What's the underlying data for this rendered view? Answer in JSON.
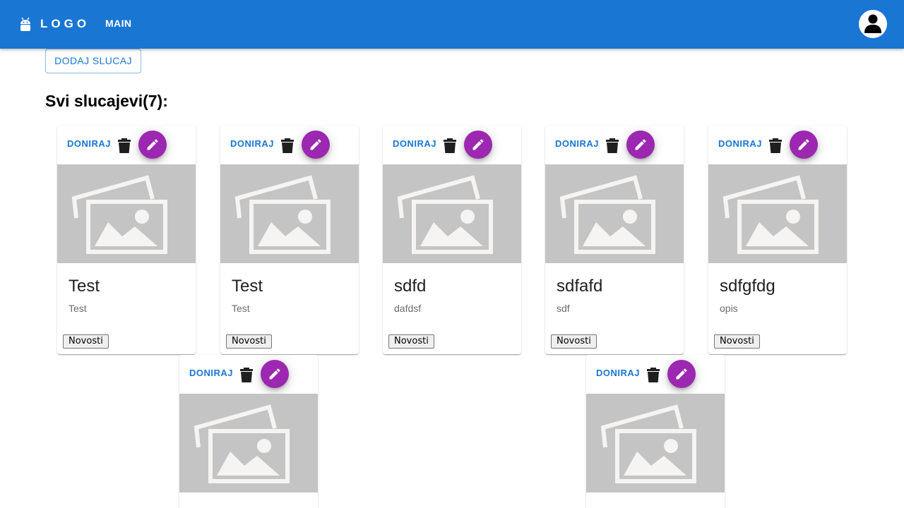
{
  "header": {
    "logo_text": "LOGO",
    "nav_main": "MAIN",
    "bar_color": "#1976d2"
  },
  "toolbar": {
    "add_case_label": "DODAJ SLUCAJ"
  },
  "page_title": "Svi slucajevi(7):",
  "icons": {
    "logo": "android-icon",
    "avatar": "account-icon",
    "delete": "trash-icon",
    "edit": "pencil-icon",
    "media": "image-placeholder-icon"
  },
  "colors": {
    "primary": "#1976d2",
    "fab": "#9c27b0",
    "placeholder_bg": "#c4c4c4"
  },
  "cards": [
    {
      "donate_label": "DONIRAJ",
      "title": "Test",
      "description": "Test",
      "tag": "Novosti"
    },
    {
      "donate_label": "DONIRAJ",
      "title": "Test",
      "description": "Test",
      "tag": "Novosti"
    },
    {
      "donate_label": "DONIRAJ",
      "title": "sdfd",
      "description": "dafdsf",
      "tag": "Novosti"
    },
    {
      "donate_label": "DONIRAJ",
      "title": "sdfafd",
      "description": "sdf",
      "tag": "Novosti"
    },
    {
      "donate_label": "DONIRAJ",
      "title": "sdfgfdg",
      "description": "opis",
      "tag": "Novosti"
    },
    {
      "donate_label": "DONIRAJ"
    },
    {
      "donate_label": "DONIRAJ"
    }
  ]
}
